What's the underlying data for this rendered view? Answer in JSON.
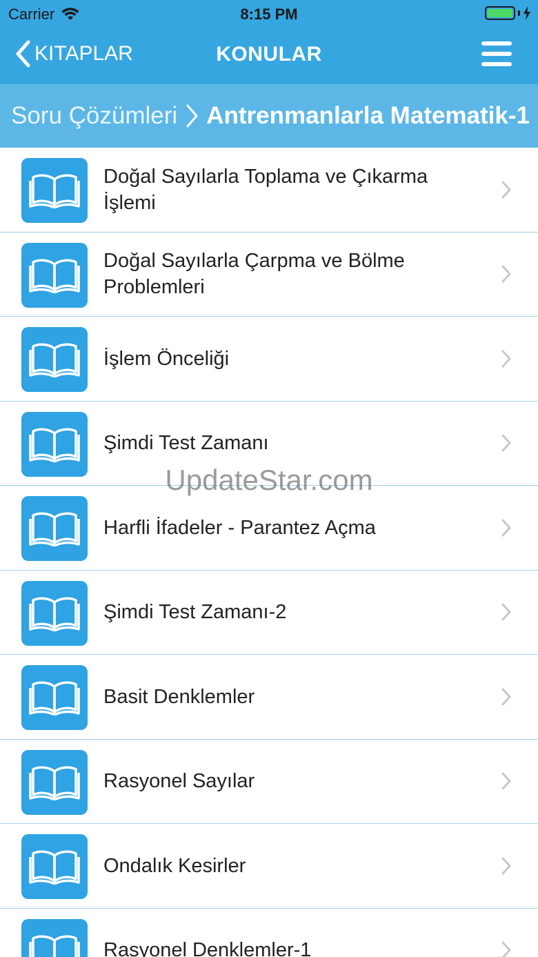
{
  "status_bar": {
    "carrier": "Carrier",
    "time": "8:15 PM"
  },
  "nav": {
    "back_label": "KITAPLAR",
    "title": "KONULAR"
  },
  "breadcrumb": {
    "root": "Soru Çözümleri",
    "current": "Antrenmanlarla Matematik-1"
  },
  "topics": [
    {
      "label": "Doğal Sayılarla Toplama ve Çıkarma İşlemi"
    },
    {
      "label": "Doğal Sayılarla Çarpma ve Bölme Problemleri"
    },
    {
      "label": "İşlem Önceliği"
    },
    {
      "label": "Şimdi Test Zamanı"
    },
    {
      "label": "Harfli İfadeler - Parantez Açma"
    },
    {
      "label": "Şimdi Test Zamanı-2"
    },
    {
      "label": "Basit Denklemler"
    },
    {
      "label": "Rasyonel Sayılar"
    },
    {
      "label": "Ondalık Kesirler"
    },
    {
      "label": "Rasyonel Denklemler-1"
    }
  ],
  "watermark": "UpdateStar.com",
  "colors": {
    "nav_bg": "#35a6e0",
    "breadcrumb_bg": "#5cb7e6",
    "icon_bg": "#2fa3e3",
    "separator": "#9ed0ec",
    "battery": "#4cd964"
  },
  "icons": {
    "row_icon": "open-book-icon",
    "row_disclosure": "chevron-right-icon",
    "back": "chevron-left-icon",
    "menu": "hamburger-menu-icon"
  }
}
